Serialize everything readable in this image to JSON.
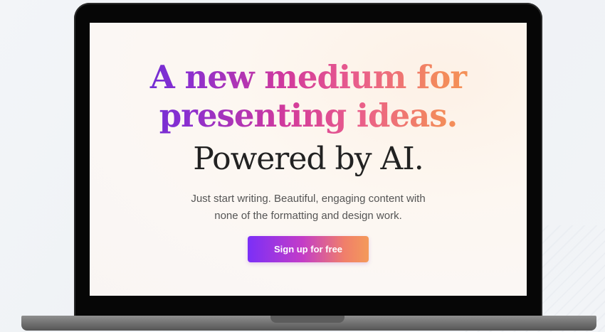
{
  "hero": {
    "headline_line1": "A new medium for",
    "headline_line2": "presenting ideas.",
    "headline_line3": "Powered by AI.",
    "subtext_line1": "Just start writing. Beautiful, engaging content with",
    "subtext_line2": "none of the formatting and design work.",
    "cta_label": "Sign up for free"
  },
  "colors": {
    "gradient_start": "#4b2bd9",
    "gradient_mid": "#d23a9c",
    "gradient_end": "#f6a04d",
    "laptop_frame": "#060606"
  }
}
